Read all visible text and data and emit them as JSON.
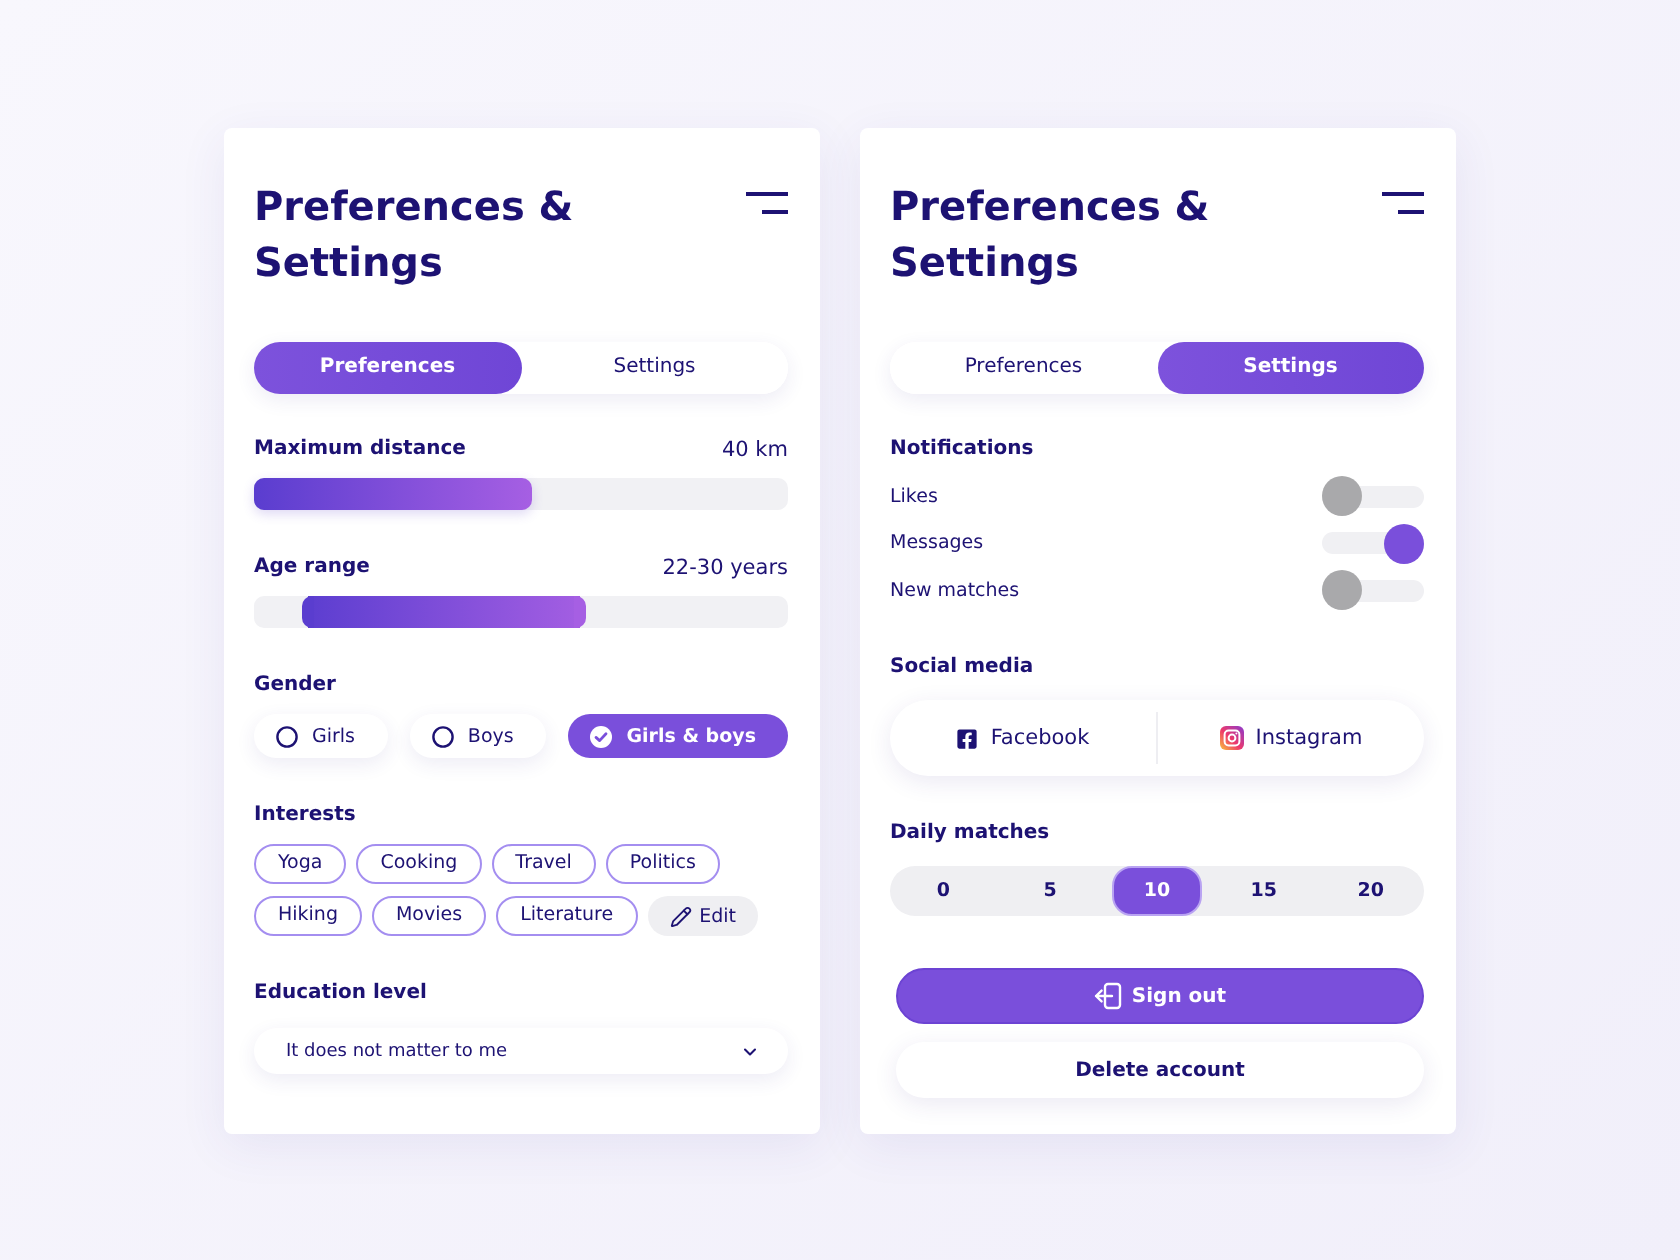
{
  "cards": [
    {
      "title": "Preferences & Settings",
      "tabs": [
        {
          "label": "Preferences",
          "selected": true
        },
        {
          "label": "Settings",
          "selected": false
        }
      ],
      "sections": [
        {
          "kind": "slider",
          "label": "Maximum distance",
          "reading": "40 km",
          "level": 0.52
        },
        {
          "kind": "range",
          "label": "Age range",
          "reading": "22-30 years",
          "handles": [
            {
              "level": 0.1
            },
            {
              "level": 0.61
            }
          ]
        },
        {
          "kind": "choice",
          "label": "Gender",
          "options": [
            {
              "label": "Girls",
              "selected": false
            },
            {
              "label": "Boys",
              "selected": false
            },
            {
              "label": "Girls & boys",
              "selected": true
            }
          ]
        },
        {
          "kind": "tags",
          "label": "Interests",
          "tags": [
            "Yoga",
            "Cooking",
            "Travel",
            "Politics",
            "Hiking",
            "Movies",
            "Literature"
          ],
          "edit": "Edit"
        },
        {
          "kind": "dropdown",
          "label": "Education level",
          "value": "It does not matter to me"
        }
      ]
    },
    {
      "title": "Preferences & Settings",
      "tabs": [
        {
          "label": "Preferences",
          "selected": false
        },
        {
          "label": "Settings",
          "selected": true
        }
      ],
      "sections": [
        {
          "kind": "toggles",
          "label": "Notifications",
          "items": [
            {
              "label": "Likes",
              "on": false
            },
            {
              "label": "Messages",
              "on": true
            },
            {
              "label": "New matches",
              "on": false
            }
          ]
        },
        {
          "kind": "social",
          "label": "Social media",
          "links": [
            {
              "label": "Facebook",
              "kind": "facebook"
            },
            {
              "label": "Instagram",
              "kind": "instagram"
            }
          ]
        },
        {
          "kind": "segments",
          "label": "Daily matches",
          "options": [
            {
              "label": "0",
              "selected": false
            },
            {
              "label": "5",
              "selected": false
            },
            {
              "label": "10",
              "selected": true
            },
            {
              "label": "15",
              "selected": false
            },
            {
              "label": "20",
              "selected": false
            }
          ]
        },
        {
          "kind": "actions",
          "buttons": [
            {
              "label": "Sign out",
              "kind": "primary"
            },
            {
              "label": "Delete account",
              "kind": "secondary"
            }
          ]
        }
      ]
    }
  ]
}
